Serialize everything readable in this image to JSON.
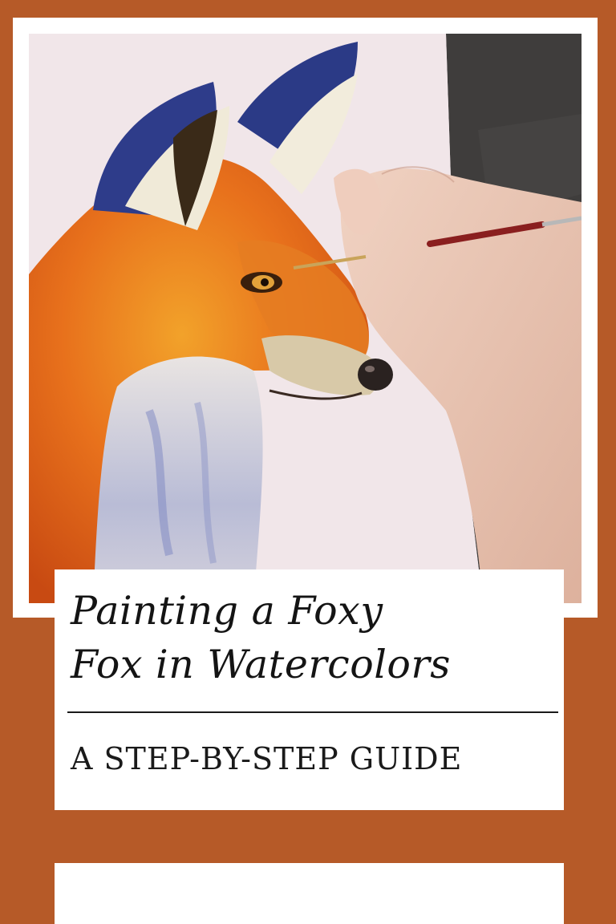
{
  "pin": {
    "title_line1": "Painting a Foxy",
    "title_line2": "Fox in Watercolors",
    "subtitle": "A STEP-BY-STEP GUIDE"
  },
  "colors": {
    "background": "#B65A28",
    "card": "#ffffff",
    "text": "#141414"
  }
}
